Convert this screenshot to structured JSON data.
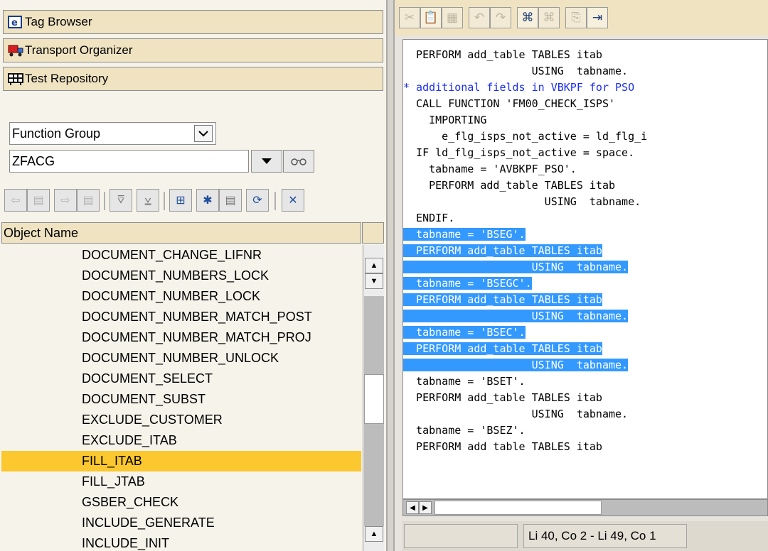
{
  "nav": {
    "tag_browser": "Tag Browser",
    "transport_organizer": "Transport Organizer",
    "test_repository": "Test Repository"
  },
  "object_selector": {
    "type_value": "Function Group",
    "name_value": "ZFACG"
  },
  "object_list": {
    "header": "Object Name",
    "items": [
      "DOCUMENT_CHANGE_LIFNR",
      "DOCUMENT_NUMBERS_LOCK",
      "DOCUMENT_NUMBER_LOCK",
      "DOCUMENT_NUMBER_MATCH_POST",
      "DOCUMENT_NUMBER_MATCH_PROJ",
      "DOCUMENT_NUMBER_UNLOCK",
      "DOCUMENT_SELECT",
      "DOCUMENT_SUBST",
      "EXCLUDE_CUSTOMER",
      "EXCLUDE_ITAB",
      "FILL_ITAB",
      "FILL_JTAB",
      "GSBER_CHECK",
      "INCLUDE_GENERATE",
      "INCLUDE_INIT"
    ],
    "selected": "FILL_ITAB"
  },
  "code": {
    "lines": [
      "  PERFORM add_table TABLES itab",
      "                    USING  tabname.",
      "* additional fields in VBKPF for PSO",
      "  CALL FUNCTION 'FM00_CHECK_ISPS'",
      "    IMPORTING",
      "      e_flg_isps_not_active = ld_flg_i",
      "  IF ld_flg_isps_not_active = space.",
      "    tabname = 'AVBKPF_PSO'.",
      "    PERFORM add_table TABLES itab",
      "                      USING  tabname.",
      "  ENDIF.",
      "  tabname = 'BSEG'.",
      "  PERFORM add_table TABLES itab",
      "                    USING  tabname.",
      "  tabname = 'BSEGC'.",
      "  PERFORM add_table TABLES itab",
      "                    USING  tabname.",
      "  tabname = 'BSEC'.",
      "  PERFORM add_table TABLES itab",
      "                    USING  tabname.",
      "  tabname = 'BSET'.",
      "  PERFORM add_table TABLES itab",
      "                    USING  tabname.",
      "  tabname = 'BSEZ'.",
      "  PERFORM add table TABLES itab"
    ]
  },
  "status": {
    "position": "Li 40, Co 2 - Li 49, Co 1"
  },
  "colors": {
    "selection": "#3399ff",
    "selected_item": "#fcc830",
    "comment": "#1a2ff0",
    "header_bg": "#efe3c2"
  }
}
